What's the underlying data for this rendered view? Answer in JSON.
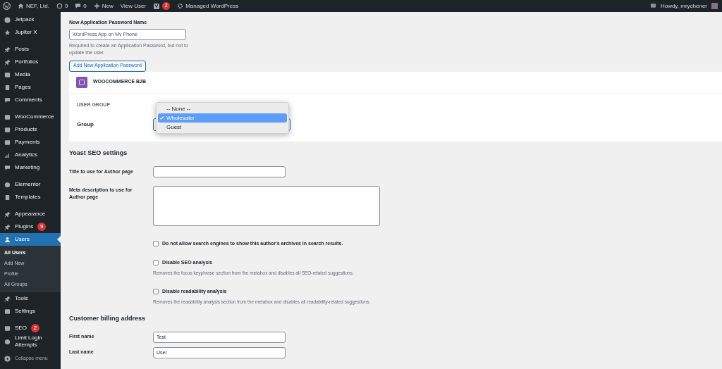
{
  "admin_bar": {
    "site": "NEF, Ltd.",
    "updates": "9",
    "comments": "0",
    "new": "New",
    "view_user": "View User",
    "seo_badge": "2",
    "managed": "Managed WordPress",
    "greeting": "Howdy, mrychener"
  },
  "sidebar": {
    "items": [
      {
        "label": "Jetpack",
        "selected": false
      },
      {
        "label": "Jupiter X",
        "selected": false
      },
      {
        "label": "Posts",
        "selected": false
      },
      {
        "label": "Portfolios",
        "selected": false
      },
      {
        "label": "Media",
        "selected": false
      },
      {
        "label": "Pages",
        "selected": false
      },
      {
        "label": "Comments",
        "selected": false
      },
      {
        "label": "WooCommerce",
        "selected": false
      },
      {
        "label": "Products",
        "selected": false
      },
      {
        "label": "Payments",
        "selected": false
      },
      {
        "label": "Analytics",
        "selected": false
      },
      {
        "label": "Marketing",
        "selected": false
      },
      {
        "label": "Elementor",
        "selected": false
      },
      {
        "label": "Templates",
        "selected": false
      },
      {
        "label": "Appearance",
        "selected": false
      },
      {
        "label": "Plugins",
        "selected": false,
        "badge": "9"
      },
      {
        "label": "Users",
        "selected": true,
        "submenu": [
          {
            "label": "All Users",
            "selected": true
          },
          {
            "label": "Add New",
            "selected": false
          },
          {
            "label": "Profile",
            "selected": false
          },
          {
            "label": "All Groups",
            "selected": false
          }
        ]
      },
      {
        "label": "Tools",
        "selected": false
      },
      {
        "label": "Settings",
        "selected": false
      },
      {
        "label": "SEO",
        "selected": false,
        "badge": "2"
      },
      {
        "label": "Limit Login Attempts",
        "selected": false
      }
    ],
    "collapse": "Collapse menu"
  },
  "app_password": {
    "label": "New Application Password Name",
    "value": "WordPress App on My Phone",
    "help": "Required to create an Application Password, but not to update the user.",
    "button": "Add New Application Password"
  },
  "b2b": {
    "title": "WOOCOMMERCE B2B",
    "section": "USER GROUP",
    "field_label": "Group",
    "options": [
      {
        "label": "-- None --",
        "selected": false
      },
      {
        "label": "Wholesaler",
        "selected": true
      },
      {
        "label": "Guest",
        "selected": false
      }
    ]
  },
  "yoast": {
    "heading": "Yoast SEO settings",
    "title_label": "Title to use for Author page",
    "meta_label": "Meta description to use for Author page",
    "checkboxes": [
      {
        "label": "Do not allow search engines to show this author's archives in search results.",
        "checked": false
      },
      {
        "label": "Disable SEO analysis",
        "checked": false,
        "help": "Removes the focus keyphrase section from the metabox and disables all SEO-related suggestions."
      },
      {
        "label": "Disable readability analysis",
        "checked": false,
        "help": "Removes the readability analysis section from the metabox and disables all readability-related suggestions."
      }
    ]
  },
  "billing": {
    "heading": "Customer billing address",
    "fields": [
      {
        "label": "First name",
        "value": "Test"
      },
      {
        "label": "Last name",
        "value": "User"
      }
    ]
  }
}
